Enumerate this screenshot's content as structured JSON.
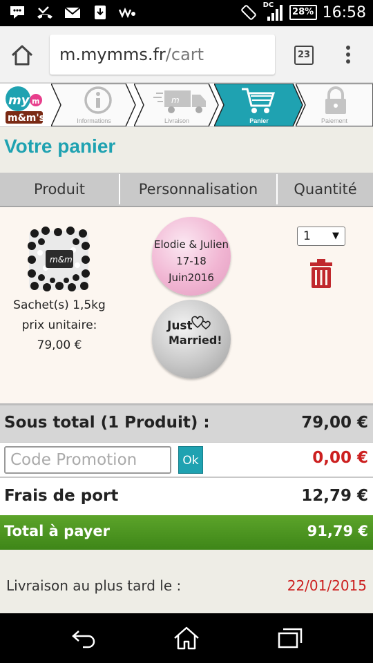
{
  "status_bar": {
    "time": "16:58",
    "battery": "28%",
    "network": "DC",
    "icons": [
      "chat-icon",
      "missed-call-icon",
      "mail-icon",
      "android-update-icon",
      "walkman-icon",
      "rotate-icon",
      "signal-icon",
      "battery-icon"
    ]
  },
  "browser": {
    "url_host": "m.mymms.fr",
    "url_path": "/cart",
    "tab_count": "23"
  },
  "steps": [
    {
      "label": "Informations",
      "icon": "info-icon",
      "active": false
    },
    {
      "label": "Livraison",
      "icon": "truck-icon",
      "active": false
    },
    {
      "label": "Panier",
      "icon": "cart-icon",
      "active": true
    },
    {
      "label": "Paiement",
      "icon": "lock-icon",
      "active": false
    }
  ],
  "page_title": "Votre panier",
  "table": {
    "headers": [
      "Produit",
      "Personnalisation",
      "Quantité"
    ]
  },
  "product": {
    "desc_line1": "Sachet(s) 1,5kg",
    "desc_line2": "prix unitaire:",
    "desc_line3": "79,00 €",
    "candy1_line1": "Elodie & Julien",
    "candy1_line2": "17-18",
    "candy1_line3": "Juin2016",
    "candy2_line1": "Just",
    "candy2_line2": "Married!",
    "quantity": "1"
  },
  "summary": {
    "subtotal_label": "Sous total (1 Produit) :",
    "subtotal_value": "79,00 €",
    "promo_placeholder": "Code Promotion",
    "promo_button": "Ok",
    "promo_value": "0,00 €",
    "shipping_label": "Frais de port",
    "shipping_value": "12,79 €",
    "total_label": "Total à payer",
    "total_value": "91,79 €",
    "delivery_label": "Livraison au plus tard le :",
    "delivery_date": "22/01/2015"
  },
  "colors": {
    "accent": "#1fa2b1",
    "total_green": "#4a9420",
    "price_red": "#cc1f1f",
    "trash_red": "#c0282d"
  }
}
